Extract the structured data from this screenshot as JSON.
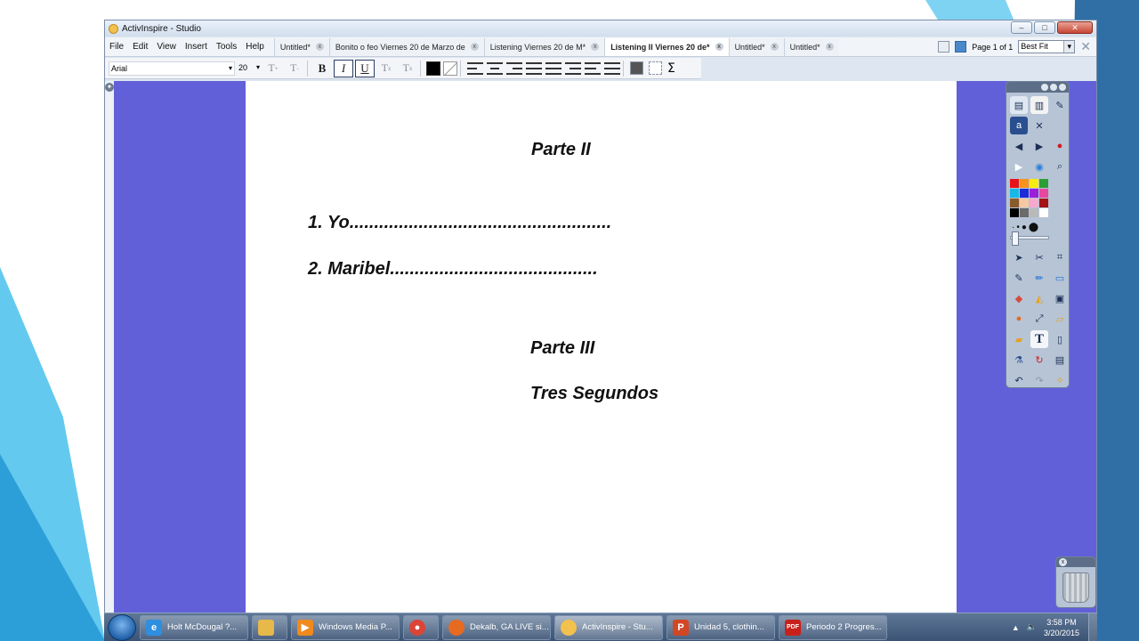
{
  "window": {
    "title": "ActivInspire - Studio",
    "controls": [
      "–",
      "□",
      "✕"
    ]
  },
  "menu": [
    "File",
    "Edit",
    "View",
    "Insert",
    "Tools",
    "Help"
  ],
  "tabs": [
    {
      "label": "Untitled*",
      "active": false
    },
    {
      "label": "Bonito o feo Viernes 20 de Marzo de",
      "active": false
    },
    {
      "label": "Listening Viernes 20 de M*",
      "active": false
    },
    {
      "label": "Listening II Viernes 20 de*",
      "active": true
    },
    {
      "label": "Untitled*",
      "active": false
    },
    {
      "label": "Untitled*",
      "active": false
    }
  ],
  "page_indicator": "Page 1 of 1",
  "zoom": "Best Fit",
  "format": {
    "font": "Arial",
    "size": "20"
  },
  "page": {
    "heading1": "Parte II",
    "item1": "1. Yo.....................................................",
    "item2": "2. Maribel..........................................",
    "heading2": "Parte III",
    "heading3": "Tres Segundos"
  },
  "colors": {
    "canvas_bg": "#6160d8",
    "palette": [
      "#e8141b",
      "#f7931e",
      "#f6ec12",
      "#2c9e37",
      "#19b7e6",
      "#1c2bd8",
      "#9b1fd8",
      "#e8479f",
      "#8a5a2b",
      "#f6c9a2",
      "#f6a8cf",
      "#a31417",
      "#000000",
      "#6b6b6b",
      "#b9b9b9",
      "#ffffff"
    ]
  },
  "taskbar": {
    "items": [
      {
        "label": "Holt McDougal ?...",
        "icon": "ie-icon",
        "color": "#2e8fe0"
      },
      {
        "label": "",
        "icon": "folder-icon",
        "color": "#e7b84a"
      },
      {
        "label": "Windows Media P...",
        "icon": "media-player-icon",
        "color": "#f08a1e"
      },
      {
        "label": "",
        "icon": "chrome-icon",
        "color": "#db4437"
      },
      {
        "label": "Dekalb, GA LIVE si...",
        "icon": "firefox-icon",
        "color": "#e66a1f"
      },
      {
        "label": "ActivInspire - Stu...",
        "icon": "activinspire-icon",
        "color": "#f2c14e"
      },
      {
        "label": "Unidad 5, clothin...",
        "icon": "powerpoint-icon",
        "color": "#d24726"
      },
      {
        "label": "Periodo 2 Progres...",
        "icon": "pdf-icon",
        "color": "#c8201a"
      }
    ],
    "time": "3:58 PM",
    "date": "3/20/2015"
  }
}
